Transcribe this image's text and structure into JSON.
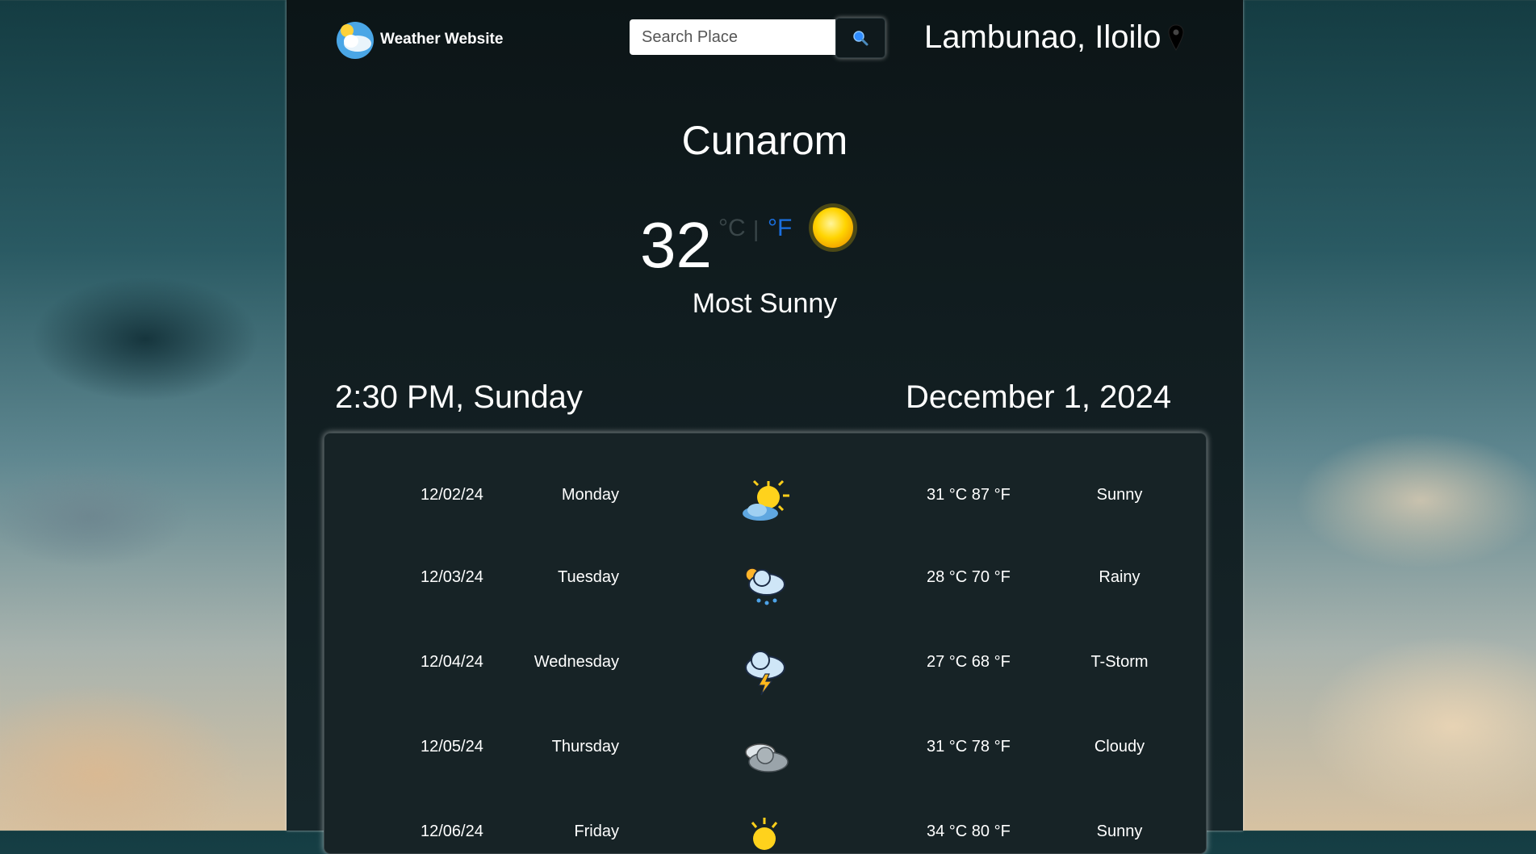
{
  "header": {
    "brand_name": "Weather Website",
    "search_placeholder": "Search Place",
    "location": "Lambunao, Iloilo"
  },
  "current": {
    "place": "Cunarom",
    "temperature": "32",
    "unit_c": "°C",
    "unit_sep": "|",
    "unit_f": "°F",
    "condition": "Most Sunny",
    "time": "2:30 PM, Sunday",
    "date": "December 1, 2024"
  },
  "forecast": [
    {
      "date": "12/02/24",
      "day": "Monday",
      "temp": "31 °C 87 °F",
      "condition": "Sunny",
      "icon": "sun-cloud-icon"
    },
    {
      "date": "12/03/24",
      "day": "Tuesday",
      "temp": "28 °C 70 °F",
      "condition": "Rainy",
      "icon": "rain-cloud-icon"
    },
    {
      "date": "12/04/24",
      "day": "Wednesday",
      "temp": "27 °C 68 °F",
      "condition": "T-Storm",
      "icon": "thunderstorm-icon"
    },
    {
      "date": "12/05/24",
      "day": "Thursday",
      "temp": "31 °C 78 °F",
      "condition": "Cloudy",
      "icon": "cloudy-icon"
    },
    {
      "date": "12/06/24",
      "day": "Friday",
      "temp": "34 °C 80 °F",
      "condition": "Sunny",
      "icon": "sun-icon"
    }
  ],
  "colors": {
    "accent_unit": "#1a6fe0",
    "panel_bg": "#111d20"
  }
}
